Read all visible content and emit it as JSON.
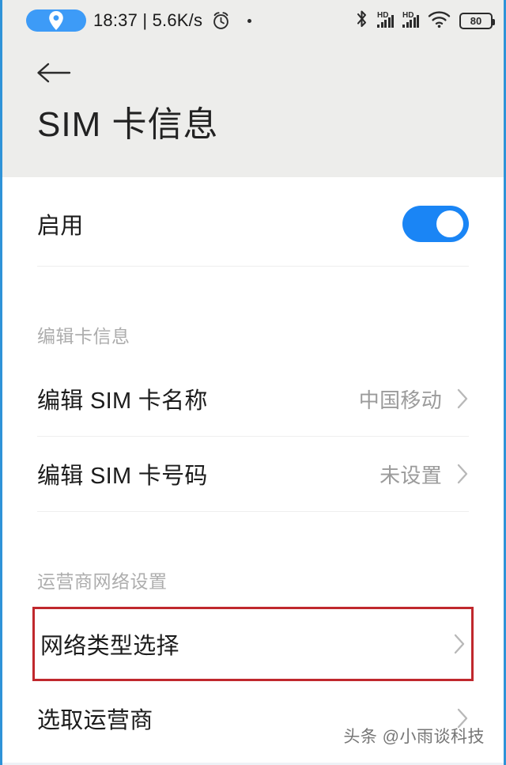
{
  "statusbar": {
    "location_icon": "location-pin-icon",
    "time": "18:37",
    "separator": "|",
    "network_speed": "5.6K/s",
    "time_speed_text": "18:37 | 5.6K/s",
    "alarm_icon": "alarm-clock-icon",
    "notification_dot": "notification-dot-icon",
    "bluetooth_icon": "bluetooth-icon",
    "sim1_label": "HD",
    "sim2_label": "HD",
    "wifi_icon": "wifi-icon",
    "battery_level": "80"
  },
  "header": {
    "back_icon": "back-arrow-icon",
    "title": "SIM 卡信息"
  },
  "enable_row": {
    "label": "启用",
    "toggle_state": "on"
  },
  "sections": [
    {
      "title": "编辑卡信息",
      "rows": [
        {
          "label": "编辑 SIM 卡名称",
          "value": "中国移动",
          "chevron": "chevron-right-icon"
        },
        {
          "label": "编辑 SIM 卡号码",
          "value": "未设置",
          "chevron": "chevron-right-icon"
        }
      ]
    },
    {
      "title": "运营商网络设置",
      "rows": [
        {
          "label": "网络类型选择",
          "value": "",
          "chevron": "chevron-right-icon",
          "highlighted": true
        },
        {
          "label": "选取运营商",
          "value": "",
          "chevron": "chevron-right-icon",
          "highlighted": false
        }
      ]
    }
  ],
  "watermark": "头条 @小雨谈科技",
  "colors": {
    "accent_blue": "#1a85f5",
    "status_bg": "#ededeb",
    "annotation_red": "#c0282d",
    "value_gray": "#9b9b9b",
    "section_gray": "#adadad",
    "frame_blue": "#2f93d8"
  }
}
